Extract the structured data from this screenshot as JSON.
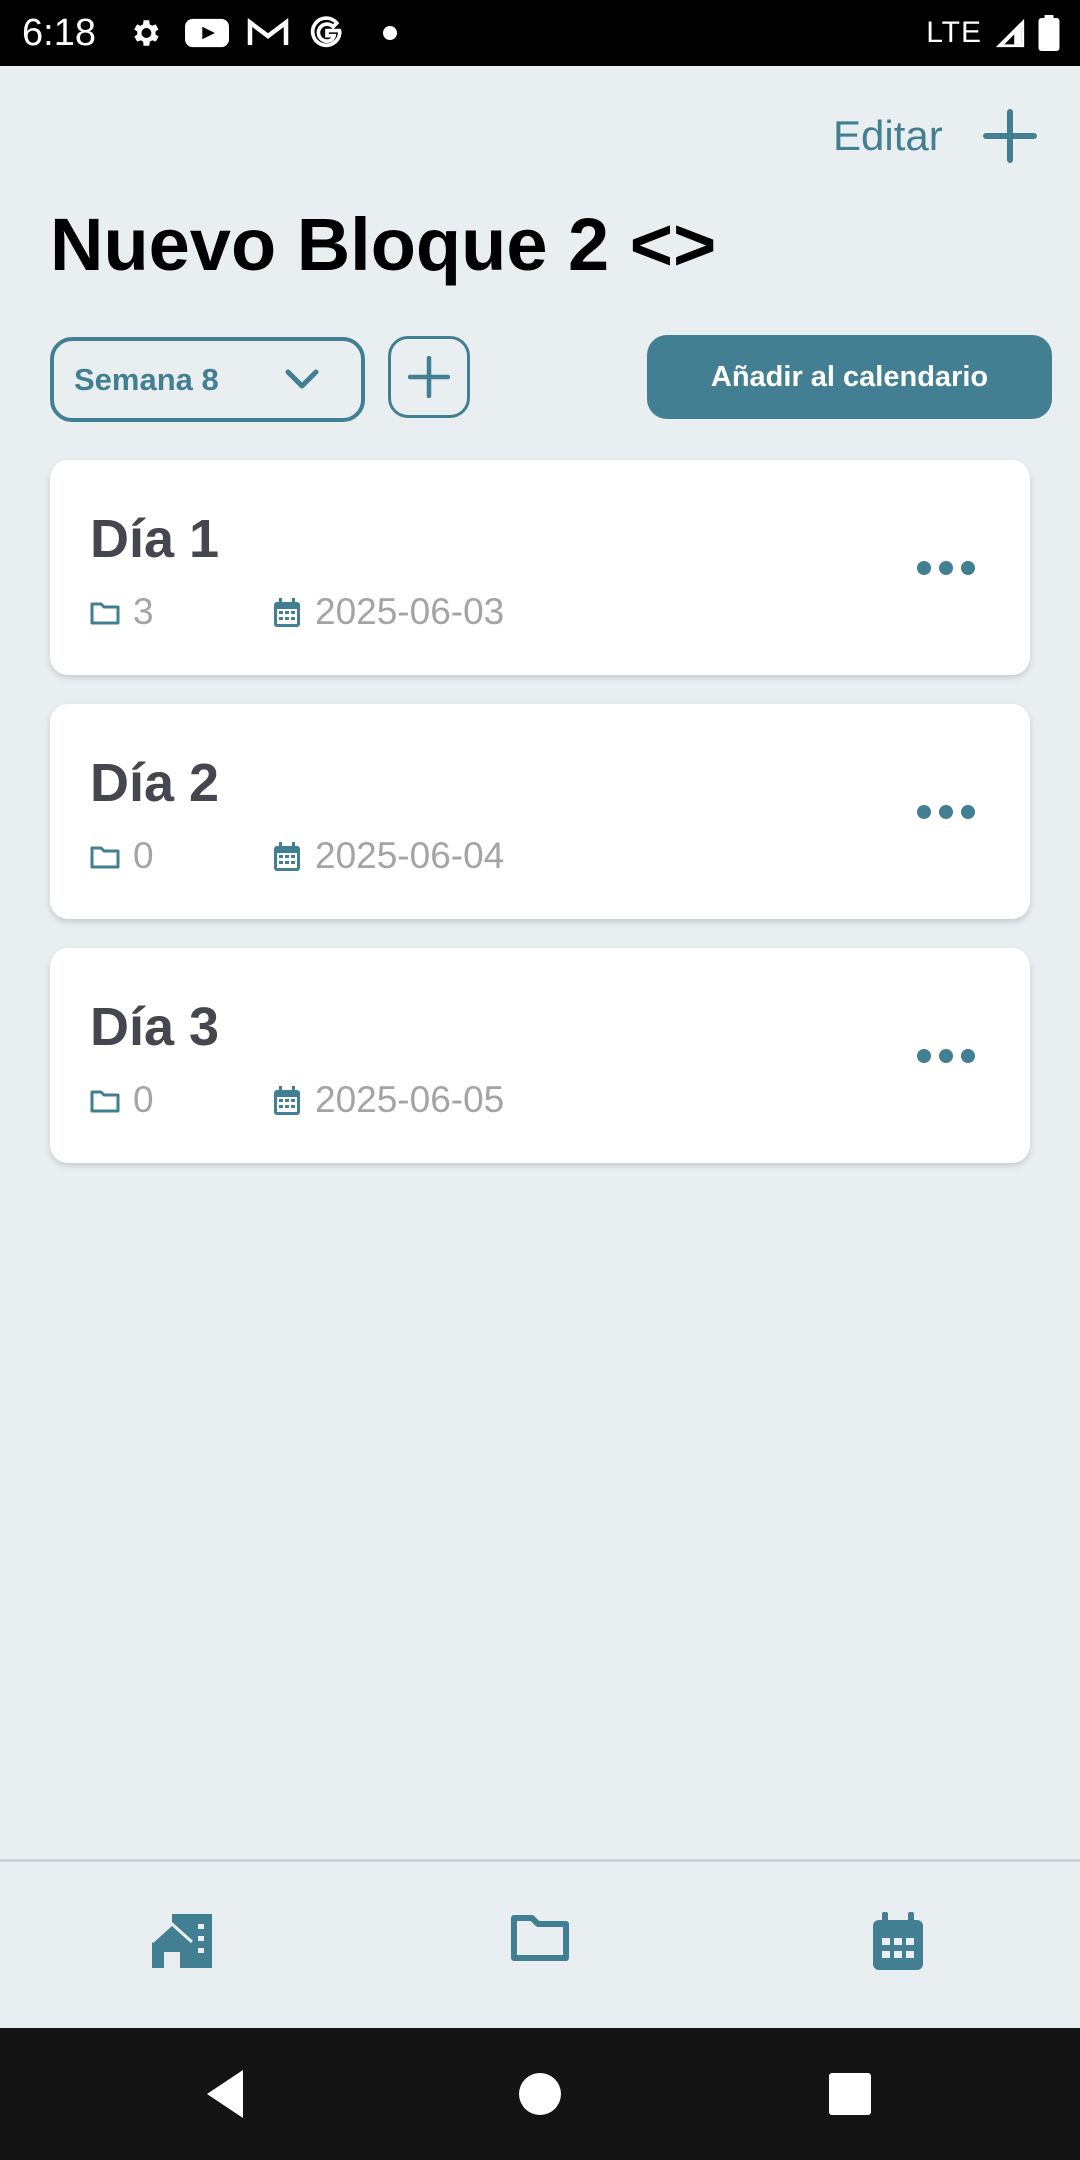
{
  "status_bar": {
    "time": "6:18",
    "network": "LTE",
    "icons": [
      "gear-icon",
      "youtube-icon",
      "gmail-icon",
      "google-icon",
      "dot-icon",
      "signal-icon",
      "battery-icon"
    ]
  },
  "header": {
    "edit_label": "Editar",
    "title": "Nuevo Bloque 2 <>"
  },
  "controls": {
    "week_selected": "Semana 8",
    "calendar_button_label": "Añadir al calendario"
  },
  "days": [
    {
      "title": "Día 1",
      "folder_count": "3",
      "date": "2025-06-03"
    },
    {
      "title": "Día 2",
      "folder_count": "0",
      "date": "2025-06-04"
    },
    {
      "title": "Día 3",
      "folder_count": "0",
      "date": "2025-06-05"
    }
  ],
  "bottom_nav": {
    "items": [
      "home-icon",
      "folder-icon",
      "calendar-icon"
    ]
  },
  "colors": {
    "accent": "#437F92",
    "background": "#E9EEF1",
    "card": "#FFFFFF",
    "day_title": "#46464E",
    "muted_text": "#A4A4A8"
  }
}
